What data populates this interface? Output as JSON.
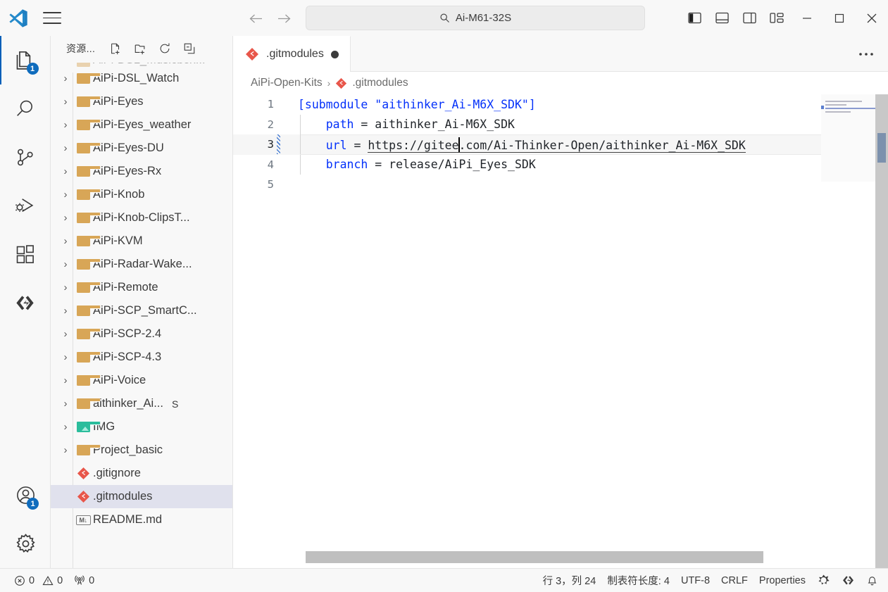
{
  "window": {
    "title": "Ai-M61-32S",
    "search_icon": "search-icon",
    "logo_icon": "vscode-logo-icon",
    "menu_icon": "hamburger-menu-icon",
    "nav_back": "←",
    "nav_forward": "→",
    "layout_buttons": [
      {
        "name": "toggle-primary-sidebar",
        "label": "Toggle Primary Side Bar"
      },
      {
        "name": "toggle-panel",
        "label": "Toggle Panel"
      },
      {
        "name": "toggle-secondary-sidebar",
        "label": "Toggle Secondary Side Bar"
      },
      {
        "name": "customize-layout",
        "label": "Customize Layout"
      }
    ],
    "controls": {
      "minimize": "—",
      "maximize": "□",
      "close": "✕"
    }
  },
  "activity_bar": {
    "items": [
      {
        "name": "explorer",
        "icon": "files-icon",
        "badge": "1",
        "active": true
      },
      {
        "name": "search",
        "icon": "search-icon",
        "badge": "",
        "active": false
      },
      {
        "name": "source-control",
        "icon": "source-control-icon",
        "badge": "",
        "active": false
      },
      {
        "name": "run-and-debug",
        "icon": "debug-icon",
        "badge": "",
        "active": false
      },
      {
        "name": "extensions",
        "icon": "extensions-icon",
        "badge": "",
        "active": false
      },
      {
        "name": "remote-explorer",
        "icon": "remote-icon",
        "badge": "",
        "active": false
      }
    ],
    "bottom_items": [
      {
        "name": "accounts",
        "icon": "account-icon",
        "badge": "1"
      },
      {
        "name": "manage",
        "icon": "gear-icon",
        "badge": ""
      }
    ]
  },
  "sidebar": {
    "title": "资源...",
    "actions": [
      {
        "name": "new-file",
        "icon": "new-file-icon"
      },
      {
        "name": "new-folder",
        "icon": "new-folder-icon"
      },
      {
        "name": "refresh-explorer",
        "icon": "refresh-icon"
      },
      {
        "name": "collapse-folders",
        "icon": "collapse-all-icon"
      }
    ],
    "tree": [
      {
        "label": "AiPi-DSL_Musicbox...",
        "type": "folder",
        "expandable": true,
        "cutoff": true,
        "badge": ""
      },
      {
        "label": "AiPi-DSL_Watch",
        "type": "folder",
        "expandable": true,
        "badge": ""
      },
      {
        "label": "AiPi-Eyes",
        "type": "folder",
        "expandable": true,
        "badge": ""
      },
      {
        "label": "AiPi-Eyes_weather",
        "type": "folder",
        "expandable": true,
        "badge": ""
      },
      {
        "label": "AiPi-Eyes-DU",
        "type": "folder",
        "expandable": true,
        "badge": ""
      },
      {
        "label": "AiPi-Eyes-Rx",
        "type": "folder",
        "expandable": true,
        "badge": ""
      },
      {
        "label": "AiPi-Knob",
        "type": "folder",
        "expandable": true,
        "badge": ""
      },
      {
        "label": "AiPi-Knob-ClipsT...",
        "type": "folder",
        "expandable": true,
        "badge": ""
      },
      {
        "label": "AiPi-KVM",
        "type": "folder",
        "expandable": true,
        "badge": ""
      },
      {
        "label": "AiPi-Radar-Wake...",
        "type": "folder",
        "expandable": true,
        "badge": ""
      },
      {
        "label": "AiPi-Remote",
        "type": "folder",
        "expandable": true,
        "badge": ""
      },
      {
        "label": "AiPi-SCP_SmartC...",
        "type": "folder",
        "expandable": true,
        "badge": ""
      },
      {
        "label": "AiPi-SCP-2.4",
        "type": "folder",
        "expandable": true,
        "badge": ""
      },
      {
        "label": "AiPi-SCP-4.3",
        "type": "folder",
        "expandable": true,
        "badge": ""
      },
      {
        "label": "AiPi-Voice",
        "type": "folder",
        "expandable": true,
        "badge": ""
      },
      {
        "label": "aithinker_Ai...",
        "type": "folder",
        "expandable": true,
        "badge": "S"
      },
      {
        "label": "IMG",
        "type": "img-folder",
        "expandable": true,
        "badge": ""
      },
      {
        "label": "Project_basic",
        "type": "folder",
        "expandable": true,
        "badge": ""
      },
      {
        "label": ".gitignore",
        "type": "git",
        "expandable": false,
        "badge": ""
      },
      {
        "label": ".gitmodules",
        "type": "git",
        "expandable": false,
        "badge": "",
        "selected": true
      },
      {
        "label": "README.md",
        "type": "markdown",
        "expandable": false,
        "badge": ""
      }
    ]
  },
  "editor": {
    "tab": {
      "label": ".gitmodules",
      "icon": "git-file-icon",
      "dirty": true
    },
    "more_actions": "•••",
    "breadcrumb": [
      {
        "label": "AiPi-Open-Kits",
        "icon": ""
      },
      {
        "label": ".gitmodules",
        "icon": "git-file-icon"
      }
    ],
    "breadcrumb_separator": "›",
    "lines": [
      {
        "num": "1",
        "indent": false,
        "modified": false,
        "segments": [
          {
            "t": "[submodule ",
            "c": "tok-section"
          },
          {
            "t": "\"aithinker_Ai-M6X_SDK\"",
            "c": "tok-section"
          },
          {
            "t": "]",
            "c": "tok-section"
          }
        ]
      },
      {
        "num": "2",
        "indent": true,
        "modified": false,
        "segments": [
          {
            "t": "    ",
            "c": "tok-val"
          },
          {
            "t": "path",
            "c": "tok-key"
          },
          {
            "t": " = aithinker_Ai-M6X_SDK",
            "c": "tok-val"
          }
        ]
      },
      {
        "num": "3",
        "indent": true,
        "modified": true,
        "current": true,
        "segments": [
          {
            "t": "    ",
            "c": "tok-val"
          },
          {
            "t": "url",
            "c": "tok-key"
          },
          {
            "t": " = ",
            "c": "tok-val"
          },
          {
            "t": "https://gitee",
            "c": "tok-url"
          },
          {
            "t": "|CARET|",
            "c": "caret-marker"
          },
          {
            "t": ".com/Ai-Thinker-Open/aithinker_Ai-M6X_SDK",
            "c": "tok-url"
          }
        ]
      },
      {
        "num": "4",
        "indent": true,
        "modified": false,
        "segments": [
          {
            "t": "    ",
            "c": "tok-val"
          },
          {
            "t": "branch",
            "c": "tok-key"
          },
          {
            "t": " = release/AiPi_Eyes_SDK",
            "c": "tok-val"
          }
        ]
      },
      {
        "num": "5",
        "indent": false,
        "modified": false,
        "segments": []
      }
    ]
  },
  "status_bar": {
    "left": [
      {
        "name": "problems-errors",
        "icon": "error-icon",
        "value": "0"
      },
      {
        "name": "problems-warnings",
        "icon": "warning-icon",
        "value": "0"
      },
      {
        "name": "ports",
        "icon": "radio-tower-icon",
        "value": "0"
      }
    ],
    "right": [
      {
        "name": "cursor-position",
        "label": "行 3，列 24"
      },
      {
        "name": "indentation",
        "label": "制表符长度: 4"
      },
      {
        "name": "encoding",
        "label": "UTF-8"
      },
      {
        "name": "eol",
        "label": "CRLF"
      },
      {
        "name": "language-mode",
        "label": "Properties"
      },
      {
        "name": "gitlens",
        "label": "",
        "icon": "gitlens-icon"
      },
      {
        "name": "remote-host",
        "label": "",
        "icon": "remote-icon"
      },
      {
        "name": "notifications",
        "label": "",
        "icon": "bell-icon"
      }
    ]
  },
  "colors": {
    "accent": "#005fb8",
    "badge": "#0f6cbd",
    "folder": "#d8a657",
    "git_red": "#e8564a",
    "keyword_blue": "#0431fa",
    "selection": "#e0e1ed"
  }
}
